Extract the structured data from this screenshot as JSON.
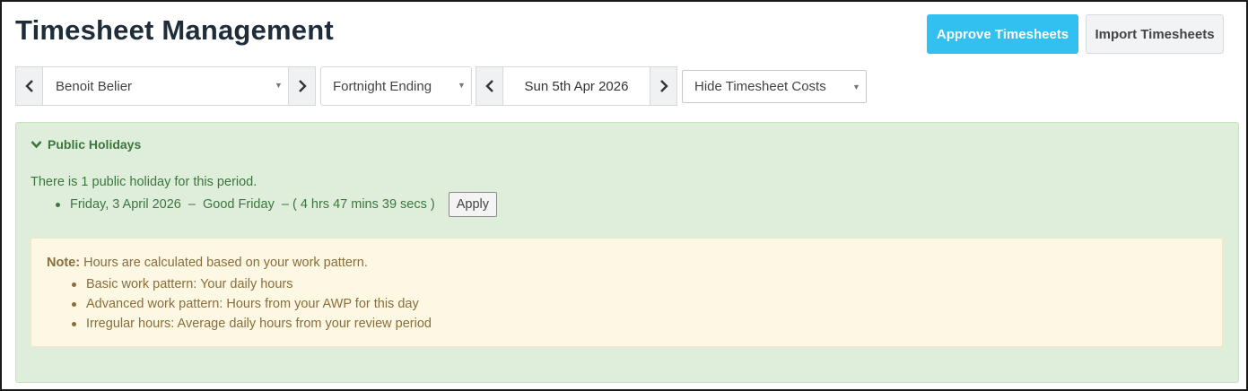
{
  "header": {
    "title": "Timesheet Management",
    "approve_label": "Approve Timesheets",
    "import_label": "Import Timesheets"
  },
  "filters": {
    "employee": "Benoit Belier",
    "period_type": "Fortnight Ending",
    "date": "Sun 5th Apr 2026",
    "costs_toggle": "Hide Timesheet Costs"
  },
  "icons": {
    "prev": "chevron-left-icon",
    "next": "chevron-right-icon",
    "collapse": "chevron-down-icon",
    "dropdown": "caret-down-icon"
  },
  "public_holidays": {
    "heading": "Public Holidays",
    "intro": "There is 1 public holiday for this period.",
    "items": [
      {
        "text": "Friday, 3 April 2026  –  Good Friday  – ( 4 hrs 47 mins 39 secs )",
        "apply_label": "Apply"
      }
    ]
  },
  "note": {
    "label": "Note:",
    "text": "Hours are calculated based on your work pattern.",
    "items": [
      "Basic work pattern: Your daily hours",
      "Advanced work pattern: Hours from your AWP for this day",
      "Irregular hours: Average daily hours from your review period"
    ]
  },
  "colors": {
    "primary": "#31c0ef",
    "success_bg": "#deeeda",
    "success_text": "#3c763d",
    "warning_bg": "#fcf8e3",
    "warning_text": "#8a6d3b"
  }
}
